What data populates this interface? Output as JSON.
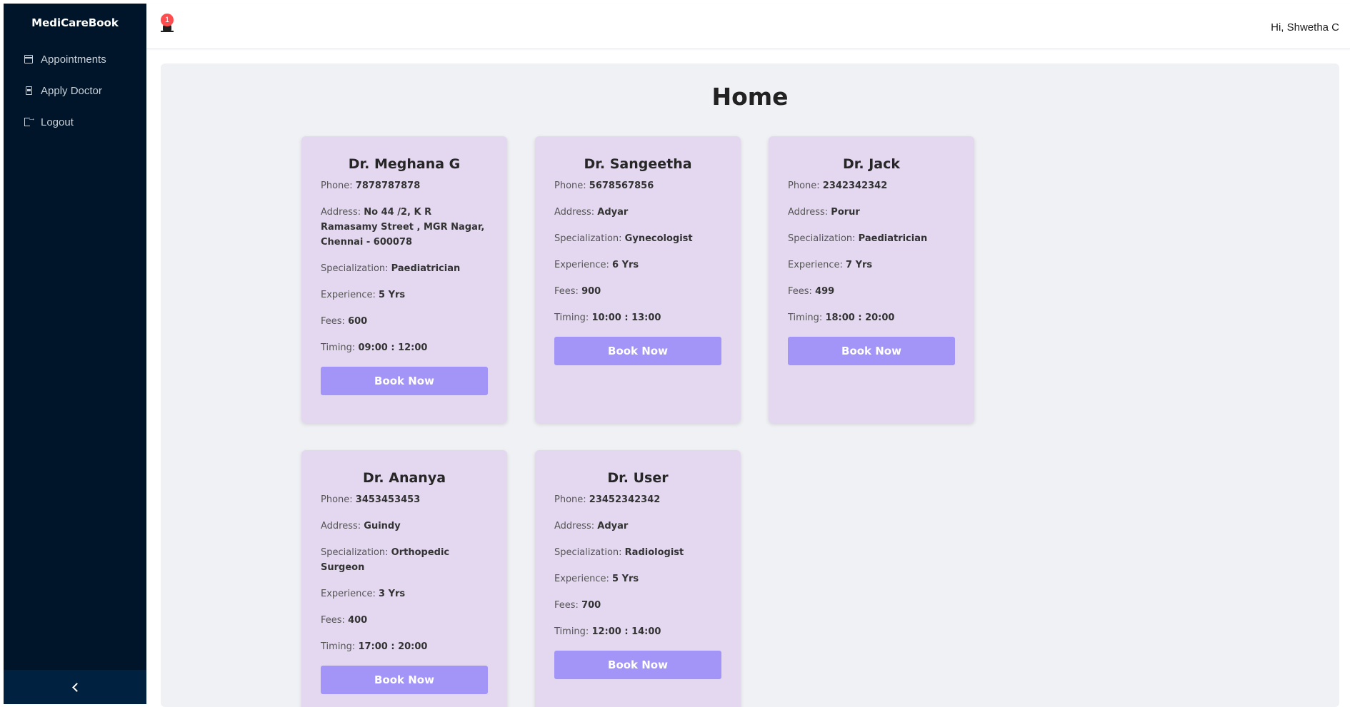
{
  "app": {
    "brand": "MediCareBook"
  },
  "sidebar": {
    "items": [
      {
        "label": "Appointments",
        "icon": "calendar-icon"
      },
      {
        "label": "Apply Doctor",
        "icon": "doctor-icon"
      },
      {
        "label": "Logout",
        "icon": "logout-icon"
      }
    ],
    "collapse_icon": "chevron-left-icon"
  },
  "header": {
    "notification_count": "1",
    "greeting": "Hi, Shwetha C"
  },
  "main": {
    "title": "Home"
  },
  "labels": {
    "phone": "Phone:",
    "address": "Address:",
    "specialization": "Specialization:",
    "experience": "Experience:",
    "fees": "Fees:",
    "timing": "Timing:",
    "book": "Book Now"
  },
  "doctors": [
    {
      "name": "Dr. Meghana G",
      "phone": "7878787878",
      "address": "No 44 /2, K R Ramasamy Street , MGR Nagar, Chennai - 600078",
      "specialization": "Paediatrician",
      "experience": "5 Yrs",
      "fees": "600",
      "timing": "09:00 : 12:00"
    },
    {
      "name": "Dr. Sangeetha",
      "phone": "5678567856",
      "address": "Adyar",
      "specialization": "Gynecologist",
      "experience": "6 Yrs",
      "fees": "900",
      "timing": "10:00 : 13:00"
    },
    {
      "name": "Dr. Jack",
      "phone": "2342342342",
      "address": "Porur",
      "specialization": "Paediatrician",
      "experience": "7 Yrs",
      "fees": "499",
      "timing": "18:00 : 20:00"
    },
    {
      "name": "Dr. Ananya",
      "phone": "3453453453",
      "address": "Guindy",
      "specialization": "Orthopedic Surgeon",
      "experience": "3 Yrs",
      "fees": "400",
      "timing": "17:00 : 20:00"
    },
    {
      "name": "Dr. User",
      "phone": "23452342342",
      "address": "Adyar",
      "specialization": "Radiologist",
      "experience": "5 Yrs",
      "fees": "700",
      "timing": "12:00 : 14:00"
    }
  ],
  "colors": {
    "sidebar_bg": "#001529",
    "card_bg": "#e4d8f0",
    "button_bg": "#a395f7",
    "badge": "#ff4d4f"
  }
}
